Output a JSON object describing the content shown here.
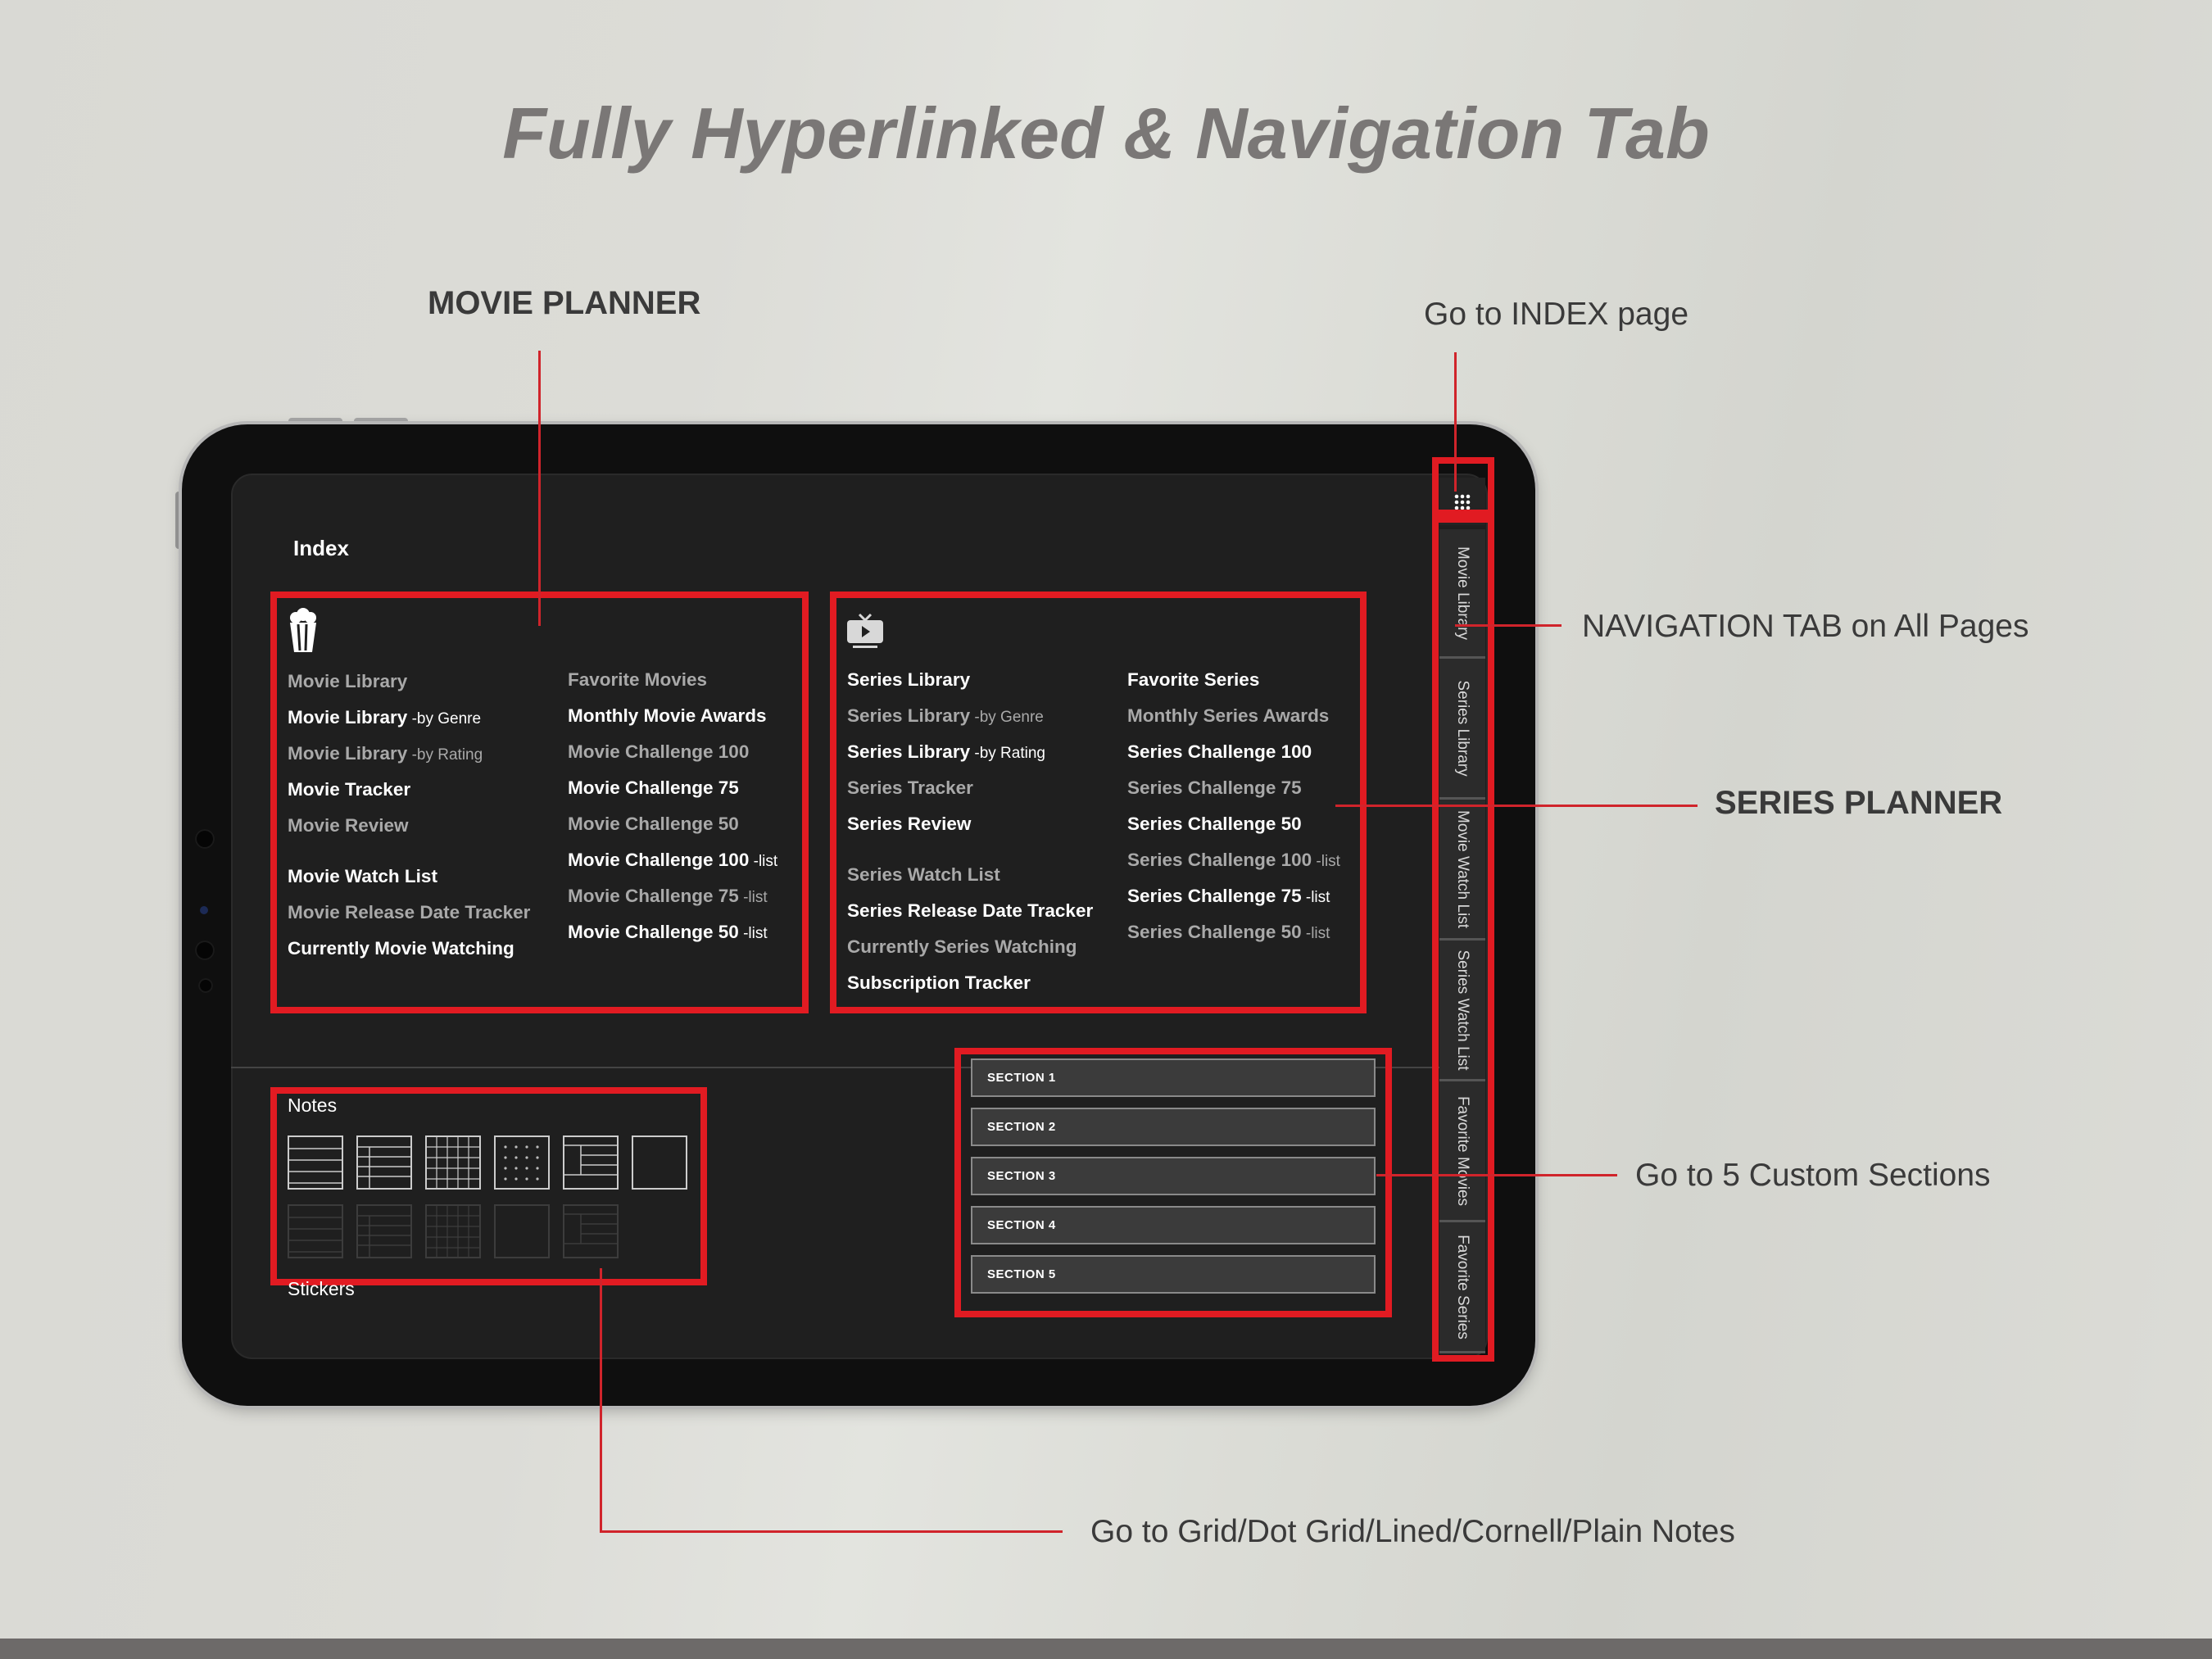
{
  "headline": "Fully Hyperlinked & Navigation Tab",
  "callouts": {
    "movie_planner": "MOVIE PLANNER",
    "index_page": "Go to INDEX page",
    "navigation_tab": "NAVIGATION TAB on All Pages",
    "series_planner": "SERIES PLANNER",
    "custom_sections": "Go to 5 Custom Sections",
    "notes": "Go to Grid/Dot Grid/Lined/Cornell/Plain Notes"
  },
  "screen": {
    "index_title": "Index",
    "movie_icon": "popcorn-icon",
    "series_icon": "tv-icon",
    "movie_col1": [
      {
        "label": "Movie Library",
        "suffix": "",
        "tone": "g"
      },
      {
        "label": "Movie Library",
        "suffix": " -by Genre",
        "tone": "w"
      },
      {
        "label": "Movie Library",
        "suffix": " -by Rating",
        "tone": "g"
      },
      {
        "label": "Movie Tracker",
        "suffix": "",
        "tone": "w"
      },
      {
        "label": "Movie Review",
        "suffix": "",
        "tone": "g"
      },
      {
        "label": "Movie Watch List",
        "suffix": "",
        "tone": "w",
        "gap": true
      },
      {
        "label": "Movie Release Date Tracker",
        "suffix": "",
        "tone": "g"
      },
      {
        "label": "Currently Movie Watching",
        "suffix": "",
        "tone": "w"
      }
    ],
    "movie_col2": [
      {
        "label": "Favorite Movies",
        "suffix": "",
        "tone": "g"
      },
      {
        "label": "Monthly Movie Awards",
        "suffix": "",
        "tone": "w"
      },
      {
        "label": "Movie Challenge 100",
        "suffix": "",
        "tone": "g"
      },
      {
        "label": "Movie Challenge 75",
        "suffix": "",
        "tone": "w"
      },
      {
        "label": "Movie Challenge 50",
        "suffix": "",
        "tone": "g"
      },
      {
        "label": "Movie Challenge 100",
        "suffix": " -list",
        "tone": "w"
      },
      {
        "label": "Movie Challenge 75",
        "suffix": " -list",
        "tone": "g"
      },
      {
        "label": "Movie Challenge 50",
        "suffix": " -list",
        "tone": "w"
      }
    ],
    "series_col1": [
      {
        "label": "Series Library",
        "suffix": "",
        "tone": "w"
      },
      {
        "label": "Series Library",
        "suffix": " -by Genre",
        "tone": "g"
      },
      {
        "label": "Series Library",
        "suffix": " -by Rating",
        "tone": "w"
      },
      {
        "label": "Series Tracker",
        "suffix": "",
        "tone": "g"
      },
      {
        "label": "Series Review",
        "suffix": "",
        "tone": "w"
      },
      {
        "label": "Series Watch List",
        "suffix": "",
        "tone": "g",
        "gap": true
      },
      {
        "label": "Series Release Date Tracker",
        "suffix": "",
        "tone": "w"
      },
      {
        "label": "Currently Series Watching",
        "suffix": "",
        "tone": "g"
      },
      {
        "label": "Subscription Tracker",
        "suffix": "",
        "tone": "w"
      }
    ],
    "series_col2": [
      {
        "label": "Favorite Series",
        "suffix": "",
        "tone": "w"
      },
      {
        "label": "Monthly Series Awards",
        "suffix": "",
        "tone": "g"
      },
      {
        "label": "Series Challenge 100",
        "suffix": "",
        "tone": "w"
      },
      {
        "label": "Series Challenge 75",
        "suffix": "",
        "tone": "g"
      },
      {
        "label": "Series Challenge 50",
        "suffix": "",
        "tone": "w"
      },
      {
        "label": "Series Challenge 100",
        "suffix": " -list",
        "tone": "g"
      },
      {
        "label": "Series Challenge 75",
        "suffix": " -list",
        "tone": "w"
      },
      {
        "label": "Series Challenge 50",
        "suffix": " -list",
        "tone": "g"
      }
    ],
    "notes_label": "Notes",
    "stickers_label": "Stickers",
    "note_templates": [
      "lined",
      "cornell-lined",
      "grid",
      "dot-grid",
      "cornell",
      "plain"
    ],
    "sections": [
      "SECTION 1",
      "SECTION 2",
      "SECTION 3",
      "SECTION 4",
      "SECTION 5"
    ],
    "index_button_icon": "grid-dots-icon",
    "nav_tabs": [
      "Movie Library",
      "Series Library",
      "Movie Watch List",
      "Series Watch List",
      "Favorite Movies",
      "Favorite Series"
    ]
  },
  "colors": {
    "accent_red": "#e11b22",
    "screen_bg": "#1f1f1f",
    "headline": "#7a7776"
  }
}
